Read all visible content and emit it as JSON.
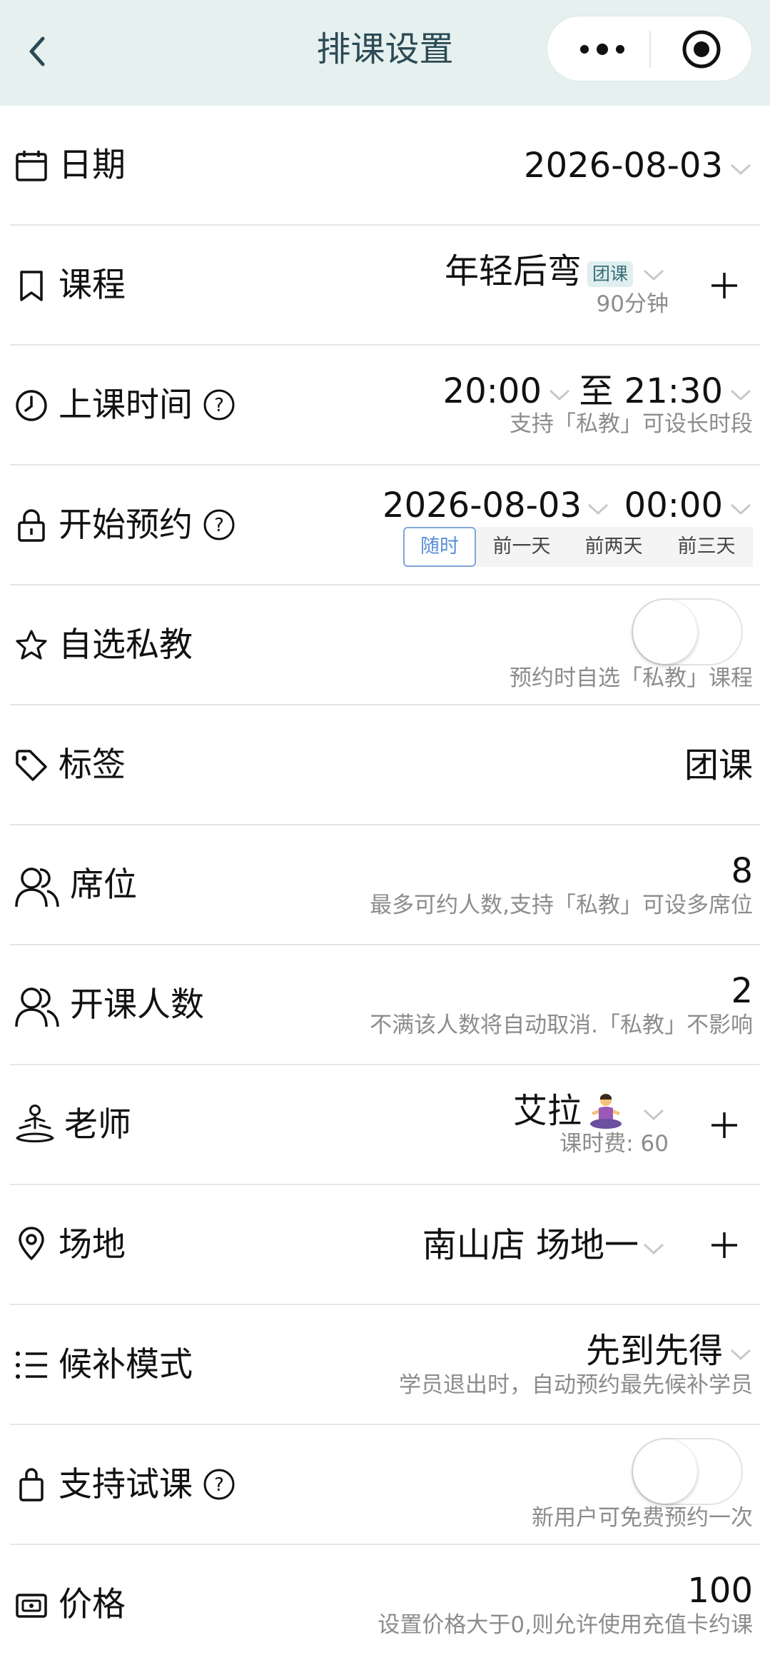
{
  "header": {
    "title": "排课设置",
    "bg_color": "#e6f0ef",
    "back_icon": "chevron-left-icon",
    "more_icon": "more-dots-icon",
    "close_icon": "target-close-icon"
  },
  "rows": {
    "date": {
      "label": "日期",
      "value": "2026-08-03",
      "icon": "calendar-icon"
    },
    "course": {
      "label": "课程",
      "value": "年轻后弯",
      "badge": "团课",
      "sub": "90分钟",
      "icon": "bookmark-icon"
    },
    "time": {
      "label": "上课时间",
      "start": "20:00",
      "to": "至",
      "end": "21:30",
      "sub": "支持「私教」可设长时段",
      "icon": "clock-icon"
    },
    "booking": {
      "label": "开始预约",
      "date": "2026-08-03",
      "time": "00:00",
      "icon": "lock-icon",
      "options": [
        "随时",
        "前一天",
        "前两天",
        "前三天"
      ],
      "selected": "随时"
    },
    "private": {
      "label": "自选私教",
      "sub": "预约时自选「私教」课程",
      "enabled": false,
      "icon": "star-icon"
    },
    "tag": {
      "label": "标签",
      "value": "团课",
      "icon": "tag-icon"
    },
    "seats": {
      "label": "席位",
      "value": "8",
      "sub": "最多可约人数,支持「私教」可设多席位",
      "icon": "users-icon"
    },
    "min_people": {
      "label": "开课人数",
      "value": "2",
      "sub": "不满该人数将自动取消.「私教」不影响",
      "icon": "users-icon"
    },
    "teacher": {
      "label": "老师",
      "value": "艾拉",
      "sub": "课时费: 60",
      "icon": "meditation-icon"
    },
    "venue": {
      "label": "场地",
      "value": "南山店 场地一",
      "icon": "location-pin-icon"
    },
    "waitlist": {
      "label": "候补模式",
      "value": "先到先得",
      "sub": "学员退出时，自动预约最先候补学员",
      "icon": "list-icon"
    },
    "trial": {
      "label": "支持试课",
      "sub": "新用户可免费预约一次",
      "enabled": false,
      "icon": "bag-icon"
    },
    "price": {
      "label": "价格",
      "value": "100",
      "sub": "设置价格大于0,则允许使用充值卡约课",
      "icon": "wallet-icon"
    }
  },
  "colors": {
    "accent": "#5b8fd6",
    "badge_bg": "#dfeeee",
    "badge_text": "#3a6f7a",
    "muted": "#8c8c8c"
  }
}
